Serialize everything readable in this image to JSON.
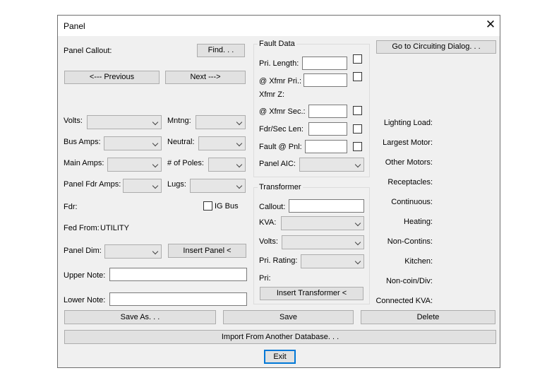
{
  "window": {
    "title": "Panel"
  },
  "icons": {
    "close": "close-icon"
  },
  "left": {
    "panel_callout": "Panel Callout:",
    "find_btn": "Find. . .",
    "prev_btn": "<--- Previous",
    "next_btn": "Next --->",
    "volts": "Volts:",
    "mntng": "Mntng:",
    "bus_amps": "Bus Amps:",
    "neutral": "Neutral:",
    "main_amps": "Main Amps:",
    "num_poles": "# of Poles:",
    "panel_fdr_amps": "Panel Fdr Amps:",
    "lugs": "Lugs:",
    "fdr": "Fdr:",
    "ig_bus": "IG Bus",
    "fed_from": "Fed From:",
    "fed_from_value": "UTILITY",
    "panel_dim": "Panel Dim:",
    "insert_panel_btn": "Insert Panel <",
    "upper_note": "Upper Note:",
    "lower_note": "Lower Note:"
  },
  "fault": {
    "title": "Fault Data",
    "pri_length": "Pri. Length:",
    "xfmr_pri": "@ Xfmr Pri.:",
    "xfmr_z": "Xfmr Z:",
    "xfmr_sec": "@ Xfmr Sec.:",
    "fdr_sec_len": "Fdr/Sec Len:",
    "fault_pnl": "Fault @ Pnl:",
    "panel_aic": "Panel AIC:"
  },
  "transformer": {
    "title": "Transformer",
    "callout": "Callout:",
    "kva": "KVA:",
    "volts": "Volts:",
    "pri_rating": "Pri. Rating:",
    "pri": "Pri:",
    "insert_btn": "Insert Transformer <"
  },
  "right": {
    "goto_btn": "Go to Circuiting Dialog. . .",
    "loads": [
      "Lighting Load:",
      "Largest Motor:",
      "Other Motors:",
      "Receptacles:",
      "Continuous:",
      "Heating:",
      "Non-Contins:",
      "Kitchen:",
      "Non-coin/Div:",
      "Connected KVA:"
    ]
  },
  "bottom": {
    "save_as": "Save As. . .",
    "save": "Save",
    "delete": "Delete",
    "import": "Import From Another Database. . .",
    "exit": "Exit"
  }
}
